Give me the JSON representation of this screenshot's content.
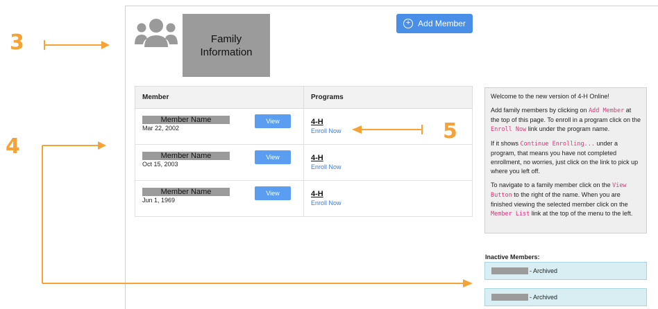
{
  "callouts": [
    {
      "number": "3"
    },
    {
      "number": "4"
    },
    {
      "number": "5"
    }
  ],
  "family": {
    "title": "Family Information",
    "icon": "people-group-icon"
  },
  "toolbar": {
    "add_member_label": "Add Member",
    "add_member_icon": "plus-circle-icon"
  },
  "table": {
    "headers": [
      "Member",
      "Programs"
    ],
    "rows": [
      {
        "name": "Member Name",
        "dob": "Mar 22, 2002",
        "view_label": "View",
        "program": "4-H",
        "enroll_label": "Enroll Now"
      },
      {
        "name": "Member Name",
        "dob": "Oct 15, 2003",
        "view_label": "View",
        "program": "4-H",
        "enroll_label": "Enroll Now"
      },
      {
        "name": "Member Name",
        "dob": "Jun 1, 1969",
        "view_label": "View",
        "program": "4-H",
        "enroll_label": "Enroll Now"
      }
    ]
  },
  "info": {
    "p1": "Welcome to the new version of 4-H Online!",
    "p2a": "Add family members by clicking on ",
    "p2code1": "Add Member",
    "p2b": " at the top of this page. To enroll in a program click on the ",
    "p2code2": "Enroll Now",
    "p2c": " link under the program name.",
    "p3a": "If it shows ",
    "p3code": "Continue Enrolling...",
    "p3b": " under a program, that means you have not completed enrollment, no worries, just click on the link to pick up where you left off.",
    "p4a": "To navigate to a family member click on the ",
    "p4code1": "View Button",
    "p4b": " to the right of the name. When you are finished viewing the selected member click on the ",
    "p4code2": "Member List",
    "p4c": " link at the top of the menu to the left."
  },
  "inactive": {
    "title": "Inactive Members:",
    "rows": [
      {
        "status": "- Archived"
      },
      {
        "status": "- Archived"
      }
    ]
  },
  "colors": {
    "accent": "#4a8fe7",
    "callout": "#f7a234",
    "link": "#3a7bd5",
    "code": "#e0337a",
    "inactive_bg": "#d8eef2"
  }
}
